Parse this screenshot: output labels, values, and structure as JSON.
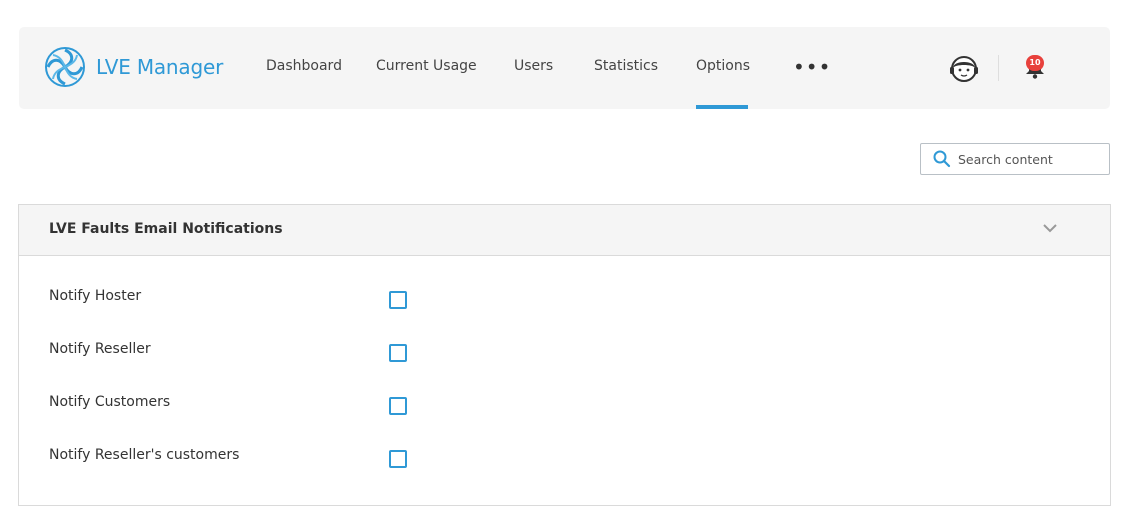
{
  "header": {
    "app_name": "LVE Manager",
    "nav": [
      {
        "label": "Dashboard"
      },
      {
        "label": "Current Usage"
      },
      {
        "label": "Users"
      },
      {
        "label": "Statistics"
      },
      {
        "label": "Options"
      }
    ],
    "active_tab": "Options",
    "more_label": "•••",
    "notification_count": "10"
  },
  "search": {
    "placeholder": "Search content"
  },
  "section": {
    "title": "LVE Faults Email Notifications",
    "options": [
      {
        "label": "Notify Hoster",
        "checked": false
      },
      {
        "label": "Notify Reseller",
        "checked": false
      },
      {
        "label": "Notify Customers",
        "checked": false
      },
      {
        "label": "Notify Reseller's customers",
        "checked": false
      }
    ]
  },
  "colors": {
    "accent": "#2f99d6",
    "badge": "#e8413c",
    "header_bg": "#f5f5f5"
  }
}
